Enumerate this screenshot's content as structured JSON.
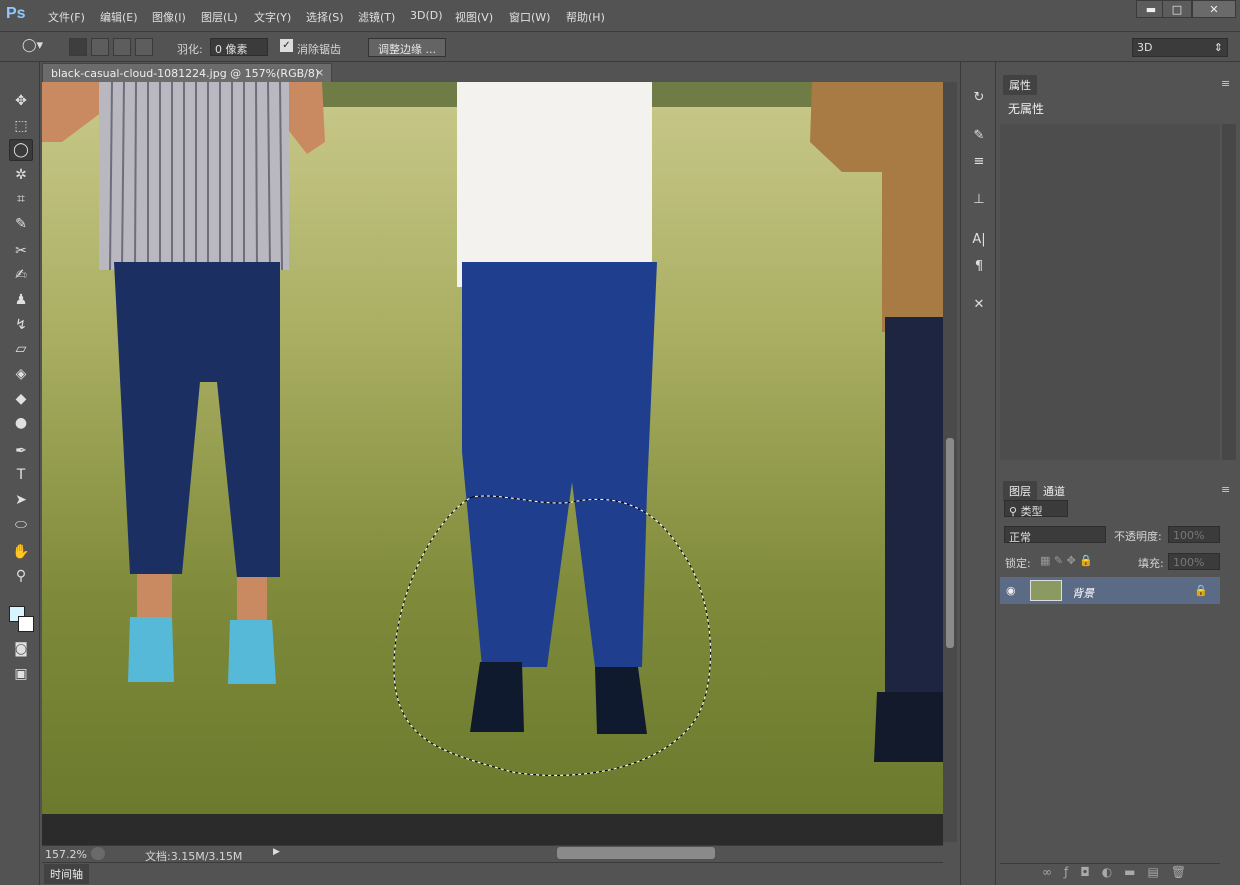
{
  "app": {
    "logo": "Ps"
  },
  "menu": [
    "文件(F)",
    "编辑(E)",
    "图像(I)",
    "图层(L)",
    "文字(Y)",
    "选择(S)",
    "滤镜(T)",
    "3D(D)",
    "视图(V)",
    "窗口(W)",
    "帮助(H)"
  ],
  "window_controls": {
    "minimize": "▬",
    "maximize": "□",
    "close": "✕"
  },
  "options": {
    "feather_label": "羽化:",
    "feather_value": "0 像素",
    "antialias_label": "消除锯齿",
    "antialias_checked": true,
    "refine_edge_button": "调整边缘 ...",
    "workspace_select": "3D"
  },
  "document": {
    "tab_title": "black-casual-cloud-1081224.jpg @ 157%(RGB/8) *",
    "close": "×"
  },
  "status": {
    "zoom": "157.2%",
    "doc_info": "文档:3.15M/3.15M"
  },
  "timeline": {
    "label": "时间轴"
  },
  "properties_panel": {
    "tab": "属性",
    "content": "无属性"
  },
  "layers_panel": {
    "tabs": [
      "图层",
      "通道"
    ],
    "filter_kind": "类型",
    "blend_mode": "正常",
    "opacity_label": "不透明度:",
    "opacity_value": "100%",
    "lock_label": "锁定:",
    "fill_label": "填充:",
    "fill_value": "100%",
    "layers": [
      {
        "name": "背景",
        "visible": true,
        "locked": true
      }
    ]
  },
  "colors": {
    "ui_bg": "#535353",
    "dark": "#3b3b3b",
    "selected_layer": "#5b6b85",
    "ps_blue": "#8fc8ff"
  },
  "icons": [
    "move-icon",
    "marquee-icon",
    "lasso-icon",
    "magic-wand-icon",
    "crop-icon",
    "eyedropper-icon",
    "healing-icon",
    "brush-icon",
    "stamp-icon",
    "history-brush-icon",
    "eraser-icon",
    "bucket-icon",
    "blur-icon",
    "dodge-icon",
    "pen-icon",
    "type-icon",
    "path-select-icon",
    "ellipse-icon",
    "hand-icon",
    "zoom-icon"
  ]
}
